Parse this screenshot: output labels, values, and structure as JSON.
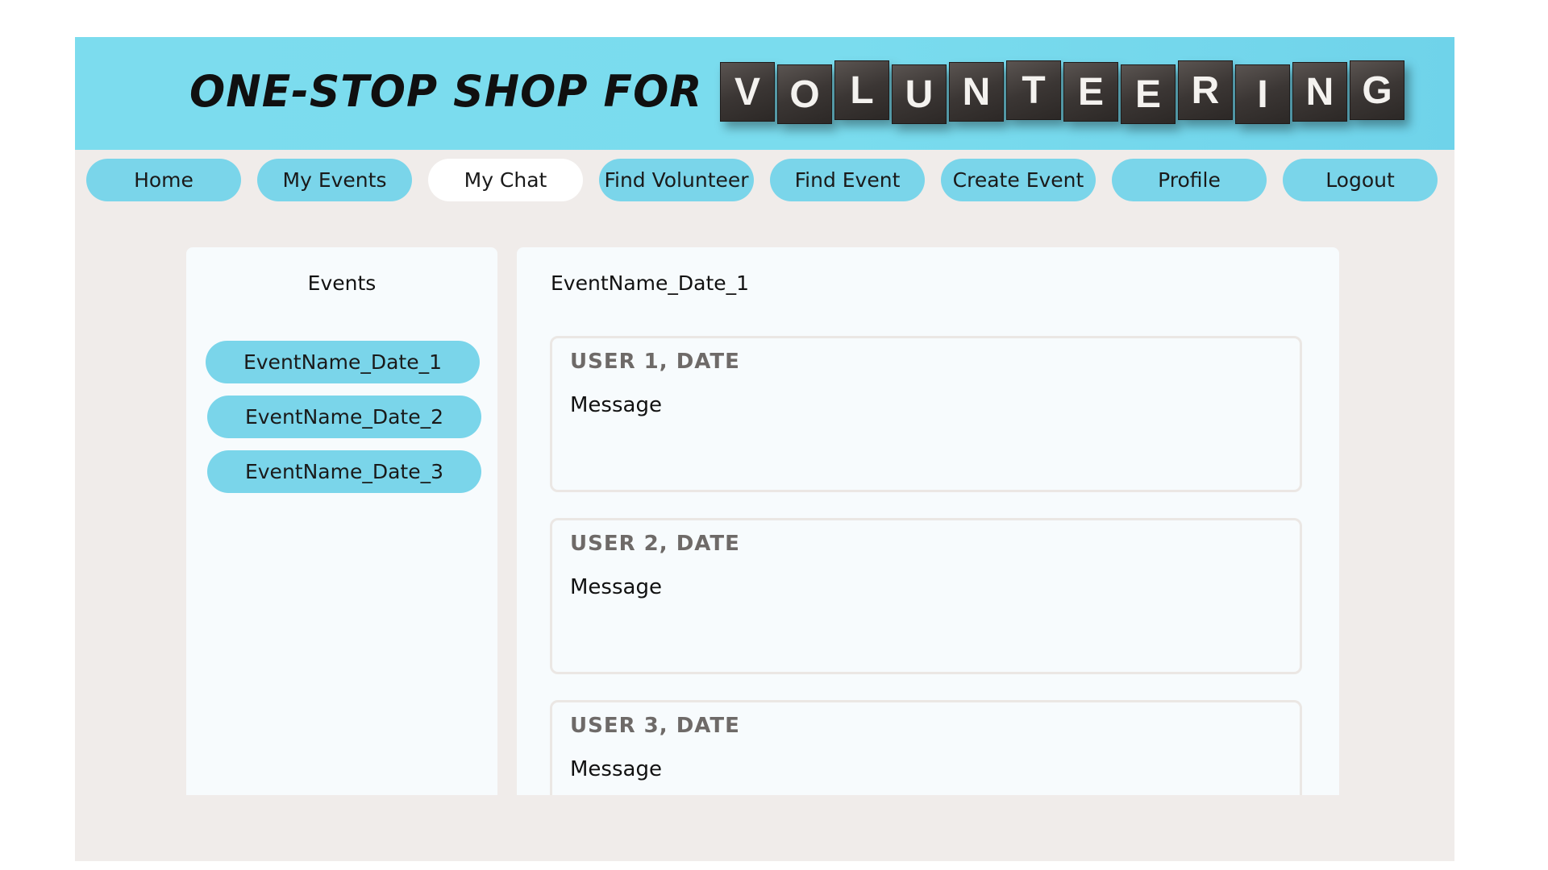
{
  "header": {
    "title": "ONE-STOP SHOP FOR",
    "tiles": [
      "V",
      "O",
      "L",
      "U",
      "N",
      "T",
      "E",
      "E",
      "R",
      "I",
      "N",
      "G"
    ],
    "accent_color": "#7ad5ea"
  },
  "nav": {
    "items": [
      {
        "label": "Home"
      },
      {
        "label": "My Events"
      },
      {
        "label": "My Chat",
        "active": true
      },
      {
        "label": "Find Volunteer"
      },
      {
        "label": "Find Event"
      },
      {
        "label": "Create Event"
      },
      {
        "label": "Profile"
      },
      {
        "label": "Logout"
      }
    ]
  },
  "events_panel": {
    "heading": "Events",
    "items": [
      "EventName_Date_1",
      "EventName_Date_2",
      "EventName_Date_3"
    ]
  },
  "chat": {
    "heading": "EventName_Date_1",
    "messages": [
      {
        "user": "USER 1, DATE",
        "text": "Message"
      },
      {
        "user": "USER 2, DATE",
        "text": "Message"
      },
      {
        "user": "USER 3, DATE",
        "text": "Message"
      }
    ]
  }
}
